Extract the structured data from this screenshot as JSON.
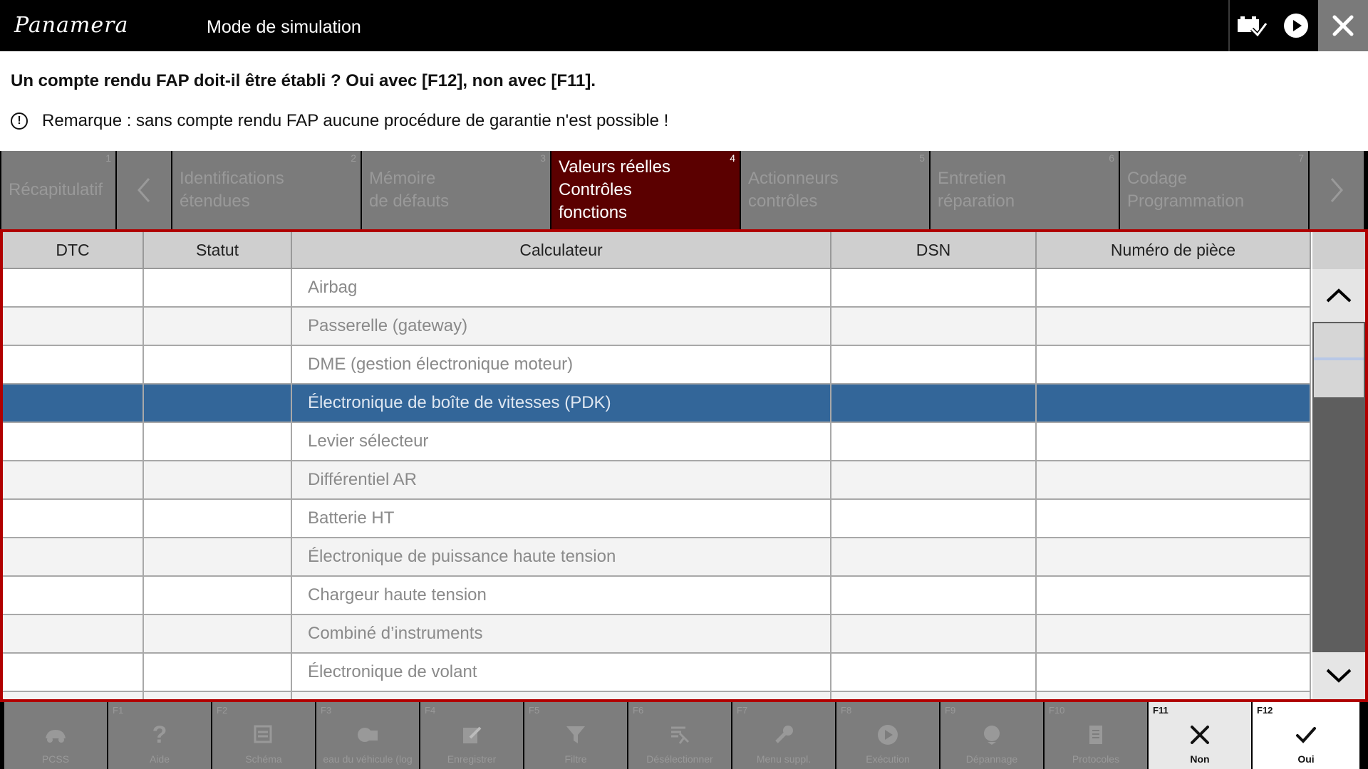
{
  "header": {
    "logo": "Panamera",
    "title": "Mode de simulation"
  },
  "prompt": {
    "question": "Un compte rendu FAP doit-il être établi ? Oui avec [F12], non avec [F11].",
    "remark": "Remarque : sans compte rendu FAP aucune procédure de garantie n'est possible !"
  },
  "tabs": [
    {
      "num": "1",
      "line1": "Récapitulatif",
      "line2": ""
    },
    {
      "num": "2",
      "line1": "Identifications",
      "line2": "étendues"
    },
    {
      "num": "3",
      "line1": "Mémoire",
      "line2": "de défauts"
    },
    {
      "num": "4",
      "line1": "Valeurs réelles",
      "line2": "Contrôles",
      "line3": "fonctions"
    },
    {
      "num": "5",
      "line1": "Actionneurs",
      "line2": "contrôles"
    },
    {
      "num": "6",
      "line1": "Entretien",
      "line2": "réparation"
    },
    {
      "num": "7",
      "line1": "Codage",
      "line2": "Programmation"
    }
  ],
  "table": {
    "columns": [
      "DTC",
      "Statut",
      "Calculateur",
      "DSN",
      "Numéro de pièce"
    ],
    "rows": [
      "Airbag",
      "Passerelle (gateway)",
      "DME (gestion électronique moteur)",
      "Électronique de boîte de vitesses (PDK)",
      "Levier sélecteur",
      "Différentiel AR",
      "Batterie HT",
      "Électronique de puissance haute tension",
      "Chargeur haute tension",
      "Combiné d’instruments",
      "Électronique de volant"
    ],
    "selected_row": 3
  },
  "fkeys": [
    {
      "key": "",
      "label": "PCSS"
    },
    {
      "key": "F1",
      "label": "Aide"
    },
    {
      "key": "F2",
      "label": "Schéma"
    },
    {
      "key": "F3",
      "label": "eau du véhicule (log"
    },
    {
      "key": "F4",
      "label": "Enregistrer"
    },
    {
      "key": "F5",
      "label": "Filtre"
    },
    {
      "key": "F6",
      "label": "Désélectionner"
    },
    {
      "key": "F7",
      "label": "Menu suppl."
    },
    {
      "key": "F8",
      "label": "Exécution"
    },
    {
      "key": "F9",
      "label": "Dépannage"
    },
    {
      "key": "F10",
      "label": "Protocoles"
    },
    {
      "key": "F11",
      "label": "Non"
    },
    {
      "key": "F12",
      "label": "Oui"
    }
  ],
  "colors": {
    "accent_red": "#b00000",
    "active_tab": "#5b0000",
    "selection": "#336699"
  }
}
